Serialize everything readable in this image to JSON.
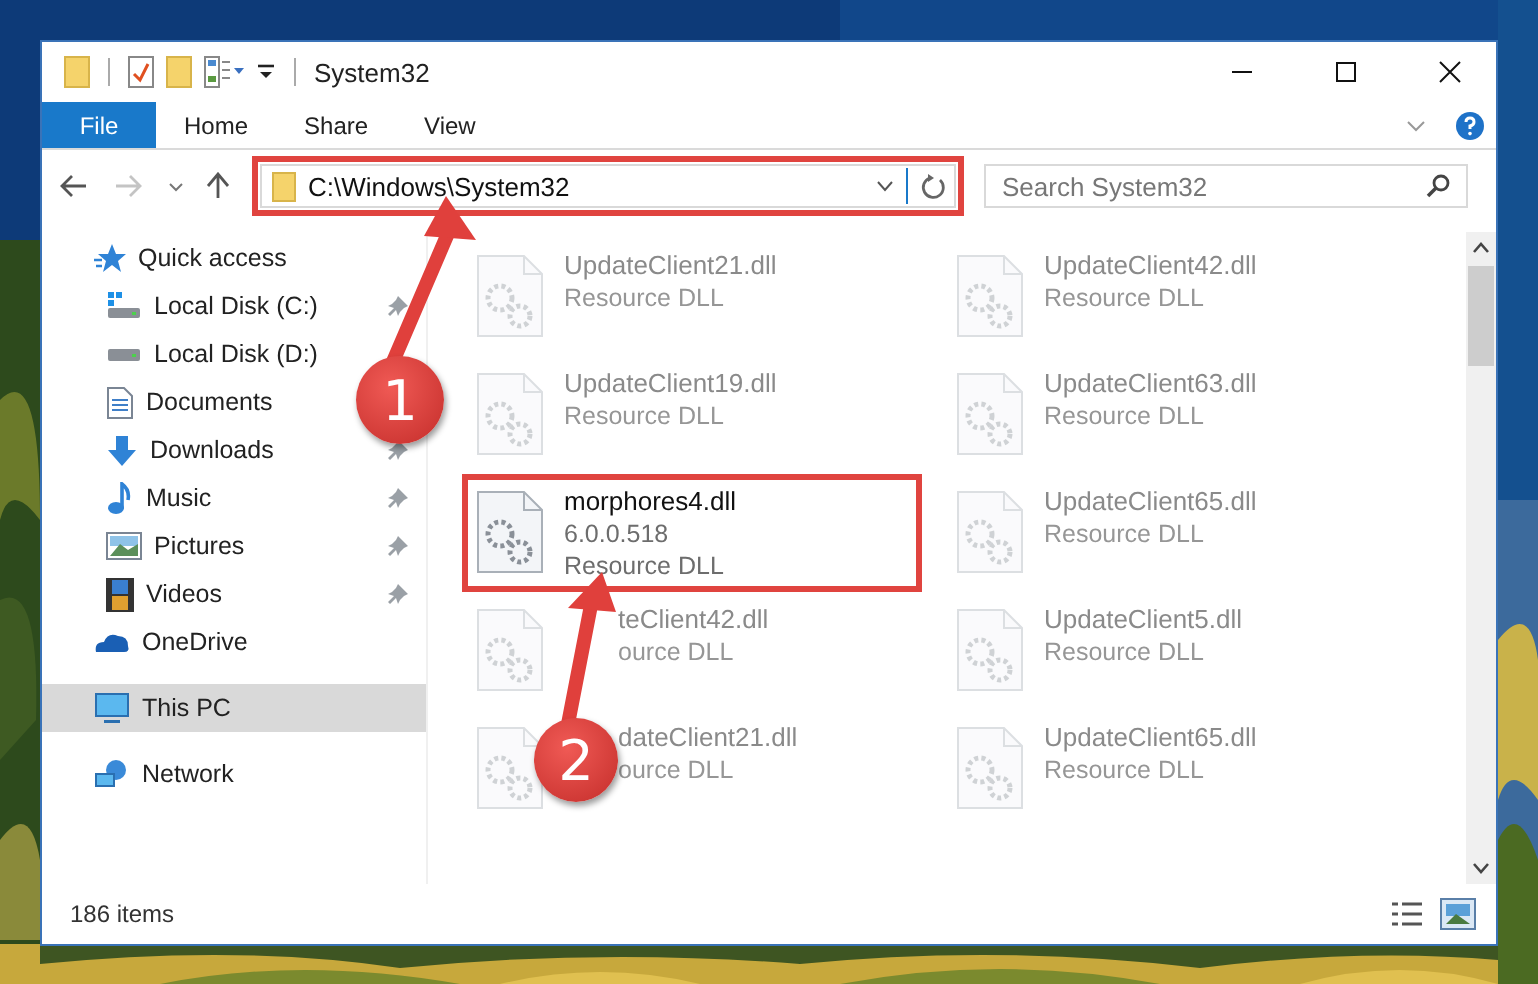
{
  "window": {
    "title": "System32"
  },
  "ribbon_tabs": [
    {
      "label": "File",
      "kind": "file",
      "selected": false
    },
    {
      "label": "Home",
      "kind": "tab",
      "selected": false
    },
    {
      "label": "Share",
      "kind": "tab",
      "selected": false
    },
    {
      "label": "View",
      "kind": "tab",
      "selected": false
    }
  ],
  "address_bar": {
    "value": "C:\\Windows\\System32",
    "highlighted": true
  },
  "search": {
    "placeholder": "Search System32"
  },
  "sidebar": {
    "items": [
      {
        "label": "Quick access",
        "kind": "star",
        "selected": false,
        "children": [
          {
            "label": "Local Disk (C:)",
            "kind": "system-drive",
            "pinned": true,
            "selected": false
          },
          {
            "label": "Local Disk (D:)",
            "kind": "drive",
            "pinned": false,
            "selected": false
          },
          {
            "label": "Documents",
            "kind": "documents",
            "pinned": false,
            "selected": false
          },
          {
            "label": "Downloads",
            "kind": "downloads",
            "pinned": true,
            "selected": false
          },
          {
            "label": "Music",
            "kind": "music",
            "pinned": true,
            "selected": false
          },
          {
            "label": "Pictures",
            "kind": "pictures",
            "pinned": true,
            "selected": false
          },
          {
            "label": "Videos",
            "kind": "videos",
            "pinned": true,
            "selected": false
          }
        ]
      },
      {
        "label": "OneDrive",
        "kind": "cloud",
        "selected": false
      },
      {
        "label": "This PC",
        "kind": "computer",
        "selected": true
      },
      {
        "label": "Network",
        "kind": "network",
        "selected": false
      }
    ]
  },
  "files": [
    {
      "name": "UpdateClient21.dll",
      "type": "Resource DLL",
      "dimmed": true,
      "highlighted": false,
      "cut": false
    },
    {
      "name": "UpdateClient42.dll",
      "type": "Resource DLL",
      "dimmed": true,
      "highlighted": false,
      "cut": false
    },
    {
      "name": "UpdateClient19.dll",
      "type": "Resource DLL",
      "dimmed": true,
      "highlighted": false,
      "cut": false
    },
    {
      "name": "UpdateClient63.dll",
      "type": "Resource DLL",
      "dimmed": true,
      "highlighted": false,
      "cut": false
    },
    {
      "name": "morphores4.dll",
      "version": "6.0.0.518",
      "type": "Resource DLL",
      "dimmed": false,
      "highlighted": true,
      "cut": false
    },
    {
      "name": "UpdateClient65.dll",
      "type": "Resource DLL",
      "dimmed": true,
      "highlighted": false,
      "cut": false
    },
    {
      "name": "teClient42.dll",
      "type": "ource DLL",
      "dimmed": true,
      "highlighted": false,
      "cut": true
    },
    {
      "name": "UpdateClient5.dll",
      "type": "Resource DLL",
      "dimmed": true,
      "highlighted": false,
      "cut": false
    },
    {
      "name": "dateClient21.dll",
      "type": "ource DLL",
      "dimmed": true,
      "highlighted": false,
      "cut": true
    },
    {
      "name": "UpdateClient65.dll",
      "type": "Resource DLL",
      "dimmed": true,
      "highlighted": false,
      "cut": false
    }
  ],
  "status_bar": {
    "item_count": "186 items"
  },
  "annotations": [
    {
      "label": "1"
    },
    {
      "label": "2"
    }
  ]
}
